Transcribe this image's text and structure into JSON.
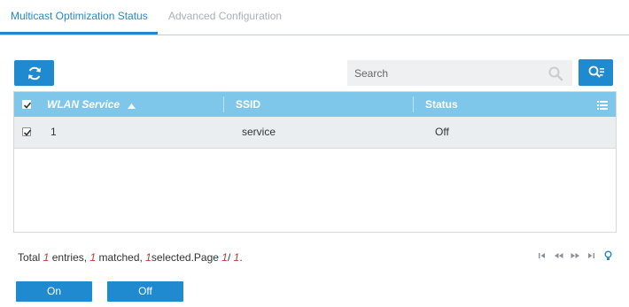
{
  "tabs": [
    {
      "label": "Multicast Optimization Status",
      "active": true
    },
    {
      "label": "Advanced Configuration",
      "active": false
    }
  ],
  "toolbar": {
    "refresh_icon": "refresh-icon",
    "search_placeholder": "Search",
    "search_value": "",
    "advanced_search_icon": "advanced-search-icon"
  },
  "grid": {
    "columns": [
      {
        "label": "WLAN Service",
        "sort": "ascending"
      },
      {
        "label": "SSID"
      },
      {
        "label": "Status"
      }
    ],
    "header_checked": true,
    "rows": [
      {
        "checked": true,
        "wlan_service": "1",
        "ssid": "service",
        "status": "Off"
      }
    ]
  },
  "footer": {
    "total_label": "Total",
    "total": "1",
    "entries_label": "entries,",
    "matched": "1",
    "matched_label": "matched,",
    "selected": "1",
    "selected_label": "selected.Page",
    "page": "1",
    "page_sep": "/",
    "pages": "1",
    "end": "."
  },
  "actions": {
    "on_label": "On",
    "off_label": "Off"
  },
  "colors": {
    "accent": "#1f8ad0",
    "grid_header": "#7fc7ea",
    "active_tab_text": "#2a86c6",
    "inactive_tab_text": "#a9b0b6",
    "footer_number": "#c0392b"
  }
}
